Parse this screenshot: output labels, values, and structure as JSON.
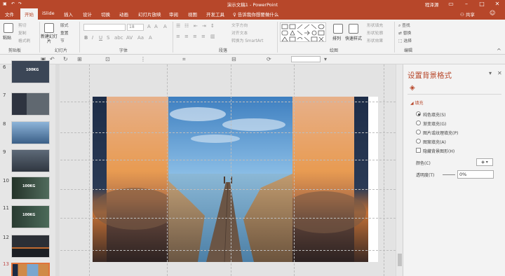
{
  "window": {
    "title": "演示文稿1 - PowerPoint",
    "user": "程泽源",
    "minimize": "–",
    "restore": "□",
    "close": "✕"
  },
  "tabs": [
    "文件",
    "开始",
    "iSlide",
    "插入",
    "设计",
    "切换",
    "动画",
    "幻灯片放映",
    "审阅",
    "视图",
    "开发工具"
  ],
  "active_tab": "开始",
  "tell_me": "告诉我你想要做什么",
  "share": "共享",
  "ribbon": {
    "clipboard": {
      "paste": "粘贴",
      "cut": "剪切",
      "copy": "复制",
      "format_painter": "格式刷",
      "label": "剪贴板"
    },
    "slides": {
      "new_slide": "新建幻灯片",
      "layout": "版式",
      "reset": "重置",
      "section": "节",
      "label": "幻灯片"
    },
    "font": {
      "font_name": "",
      "font_size": "18",
      "label": "字体"
    },
    "paragraph": {
      "text_direction": "文字方向",
      "align_text": "对齐文本",
      "smartart": "转换为 SmartArt",
      "label": "段落"
    },
    "drawing": {
      "arrange": "排列",
      "quick_styles": "快速样式",
      "shape_fill": "形状填充",
      "shape_outline": "形状轮廓",
      "shape_effects": "形状效果",
      "label": "绘图"
    },
    "editing": {
      "find": "查找",
      "replace": "替换",
      "select": "选择",
      "label": "编辑"
    }
  },
  "thumbnails": [
    {
      "num": "6",
      "text": "100KG",
      "bg": "#3b4656",
      "active": false
    },
    {
      "num": "7",
      "text": "",
      "bg": "#2e3440",
      "active": false
    },
    {
      "num": "8",
      "text": "",
      "bg": "#5a86b3",
      "active": false
    },
    {
      "num": "9",
      "text": "",
      "bg": "#4a5563",
      "active": false
    },
    {
      "num": "10",
      "text": "100KG",
      "bg": "#2c3d35",
      "active": false
    },
    {
      "num": "11",
      "text": "100KG",
      "bg": "#2f4238",
      "active": false
    },
    {
      "num": "12",
      "text": "",
      "bg": "#2b2f36",
      "active": false
    },
    {
      "num": "13",
      "text": "",
      "bg": "#c07840",
      "active": true
    }
  ],
  "format_pane": {
    "title": "设置背景格式",
    "section": "填充",
    "options": [
      "纯色填充(S)",
      "渐变填充(G)",
      "图片或纹理填充(P)",
      "图案填充(A)"
    ],
    "selected_option": 0,
    "hide_bg": "隐藏背景图形(H)",
    "color_label": "颜色(C)",
    "transparency_label": "透明度(T)",
    "transparency_value": "0%",
    "pin": "▾",
    "close": "✕"
  },
  "colors": {
    "accent": "#b7472a",
    "thumb_active": "#e0733b"
  }
}
